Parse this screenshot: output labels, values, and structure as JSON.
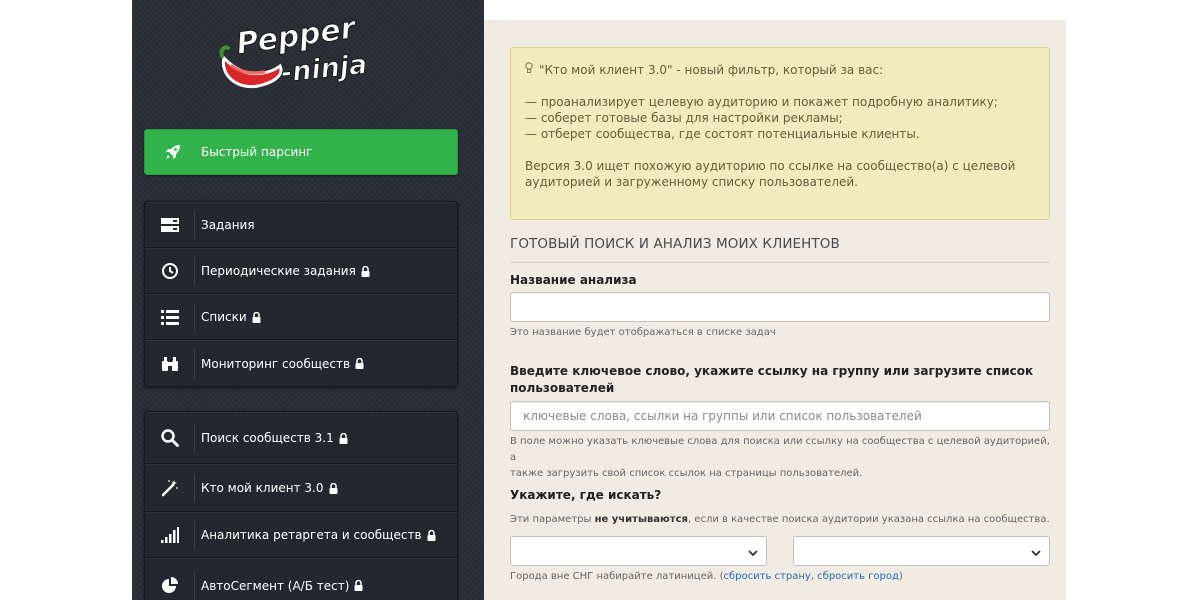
{
  "sidebar": {
    "logo": {
      "line1": "Pepper",
      "line2": "-ninja"
    },
    "quick": {
      "label": "Быстрый парсинг",
      "icon": "rocket-icon",
      "color": "#32b24a"
    },
    "group1": [
      {
        "label": "Задания",
        "icon": "server-icon",
        "locked": false
      },
      {
        "label": "Периодические задания",
        "icon": "clock-icon",
        "locked": true
      },
      {
        "label": "Списки",
        "icon": "list-icon",
        "locked": true
      },
      {
        "label": "Мониторинг сообществ",
        "icon": "binoculars-icon",
        "locked": true
      }
    ],
    "group2": [
      {
        "label": "Поиск сообществ 3.1",
        "icon": "search-icon",
        "locked": true
      },
      {
        "label": "Кто мой клиент 3.0",
        "icon": "magic-wand-icon",
        "locked": true
      },
      {
        "label": "Аналитика ретаргета и сообществ",
        "icon": "signal-bars-icon",
        "locked": true
      },
      {
        "label": "АвтоСегмент (А/Б тест)",
        "icon": "pie-chart-icon",
        "locked": true
      }
    ]
  },
  "alert": {
    "intro": "\"Кто мой клиент 3.0\" - новый фильтр, который за вас:",
    "bullets": [
      "— проанализирует целевую аудиторию и покажет подробную аналитику;",
      "— соберет готовые базы для настройки рекламы;",
      "— отберет сообщества, где состоят потенциальные клиенты."
    ],
    "version_line1": "Версия 3.0 ищет похожую аудиторию по ссылке на сообщество(а) с целевой",
    "version_line2": "аудиторией и загруженному списку пользователей."
  },
  "form": {
    "section_title": "ГОТОВЫЙ ПОИСК И АНАЛИЗ МОИХ КЛИЕНТОВ",
    "name_label": "Название анализа",
    "name_value": "",
    "name_help": "Это название будет отображаться в списке задач",
    "keywords_label_line1": "Введите ключевое слово, укажите ссылку на группу или загрузите список",
    "keywords_label_line2": "пользователей",
    "keywords_placeholder": "ключевые слова, ссылки на группы или список пользователей",
    "keywords_help_line1": "В поле можно указать ключевые слова для поиска или ссылку на сообщества с целевой аудиторией, а",
    "keywords_help_line2": "также загрузить свой список ссылок на страницы пользователей.",
    "where_label": "Укажите, где искать?",
    "where_help_before": "Эти параметры ",
    "where_help_bold": "не учитываются",
    "where_help_after": ", если в качестве поиска аудитории указана ссылка на сообщества.",
    "country_select_value": "",
    "city_select_value": "",
    "geo_help_before": "Города вне СНГ набирайте латиницей. (",
    "reset_country": "сбросить страну",
    "geo_help_comma": ", ",
    "reset_city": "сбросить город",
    "geo_help_after": ")"
  },
  "colors": {
    "sidebar_bg": "#2a2e36",
    "accent_green": "#32b24a",
    "alert_bg": "#f1ebbe",
    "content_bg": "#f0ece3",
    "link": "#2a6ab0"
  }
}
